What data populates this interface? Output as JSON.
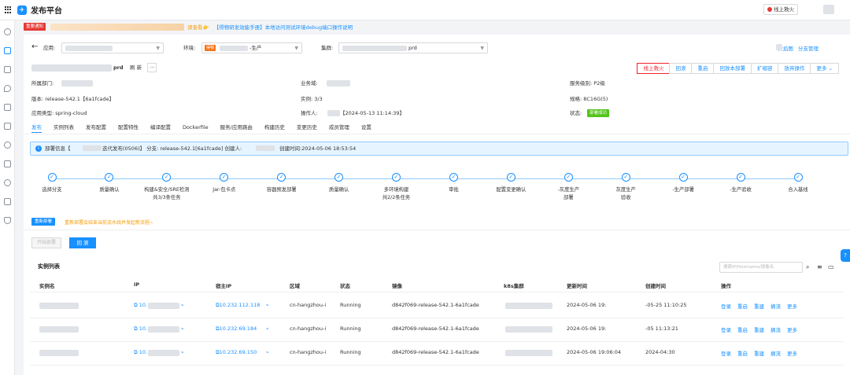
{
  "app": {
    "title": "发布平台",
    "online_button": "线上救火"
  },
  "notice": {
    "tag": "重要通知",
    "warn": "请查看👉",
    "link": "【得物研发效能手册】本地访问测试环境debug端口操作说明"
  },
  "filters": {
    "app_label": "应用:",
    "env_label": "环境:",
    "env_tag": "得物",
    "env_value": "-生产",
    "cluster_label": "集群:",
    "cluster_value": "prd"
  },
  "header_links": {
    "big_screen": "火焰图",
    "branch": "分支管理"
  },
  "title": {
    "suffix": "prd",
    "refresh": "刷 新",
    "more": "···"
  },
  "actions": [
    "线上救火",
    "回滚",
    "重启",
    "回放本部署",
    "扩缩容",
    "放弃操作",
    "更多 ⌄"
  ],
  "info": {
    "dept_label": "所属部门:",
    "biz_label": "业务域:",
    "level": "服务级别:  P2级",
    "version": "版本: release-542.1【6a1fcade】",
    "instances": "实例:  3/3",
    "spec": "规格:  8C16G(5)",
    "app_type": "应用类型:  spring-cloud",
    "operator_label": "操作人:",
    "operator_time": "【2024-05-13 11:14:39】",
    "status_label": "状态:",
    "status_value": "部署成功"
  },
  "tabs": [
    "发布",
    "实例列表",
    "发布配置",
    "配置特性",
    "编译配置",
    "Dockerfile",
    "服务/应用路由",
    "构建历史",
    "变更历史",
    "成员管理",
    "设置"
  ],
  "deploy_info": {
    "prefix": "部署信息【",
    "mid": "迭代发布(0506)】  分支: release-542.1[6a1fcade]  创建人:",
    "time": "创建时间:2024-05-06 18:53:54"
  },
  "steps": [
    {
      "l1": "选择分支",
      "l2": ""
    },
    {
      "l1": "质量确认",
      "l2": ""
    },
    {
      "l1": "构建&安全/SRE检测",
      "l2": "共3/3条任务"
    },
    {
      "l1": "Jar-包卡点",
      "l2": ""
    },
    {
      "l1": "容器预发部署",
      "l2": ""
    },
    {
      "l1": "质量确认",
      "l2": ""
    },
    {
      "l1": "多环境构建",
      "l2": "共2/2条任务"
    },
    {
      "l1": "审批",
      "l2": ""
    },
    {
      "l1": "配置变更确认",
      "l2": ""
    },
    {
      "l1": "-灰度生产",
      "l2": "部署"
    },
    {
      "l1": "灰度生产",
      "l2": "验收"
    },
    {
      "l1": "-生产部署",
      "l2": ""
    },
    {
      "l1": "-生产验收",
      "l2": ""
    },
    {
      "l1": "合入基线",
      "l2": ""
    }
  ],
  "redeploy": {
    "button": "重新部署",
    "tip": "重新部署会结束当前流水线并发起新流程~"
  },
  "buttons": {
    "start": "开始部署",
    "rollback": "回 滚"
  },
  "instances": {
    "title": "实例列表",
    "search_placeholder": "搜索IP/Hostname/镜像名",
    "headers": [
      "实例名",
      "IP",
      "宿主IP",
      "区域",
      "状态",
      "镜像",
      "k8s集群",
      "更新时间",
      "创建时间",
      "操作"
    ],
    "rows": [
      {
        "ip": "10.",
        "host_ip": "10.232.112.118",
        "zone": "cn-hangzhou-i",
        "status": "Running",
        "image": "d842f069-release-542.1-6a1fcade",
        "updated": "2024-05-06 19:",
        "created": "-05-25 11:10:25"
      },
      {
        "ip": "10.",
        "host_ip": "10.232.69.184",
        "zone": "cn-hangzhou-i",
        "status": "Running",
        "image": "d842f069-release-542.1-6a1fcade",
        "updated": "2024-05-06 19:",
        "created": "-05 11:13:21"
      },
      {
        "ip": "10.",
        "host_ip": "10.232.69.150",
        "zone": "cn-hangzhou-i",
        "status": "Running",
        "image": "d842f069-release-542.1-6a1fcade",
        "updated": "2024-05-06 19:06:04",
        "created": "2024-04:30"
      }
    ],
    "ops": [
      "登录",
      "重启",
      "重建",
      "摘流",
      "更多"
    ]
  }
}
